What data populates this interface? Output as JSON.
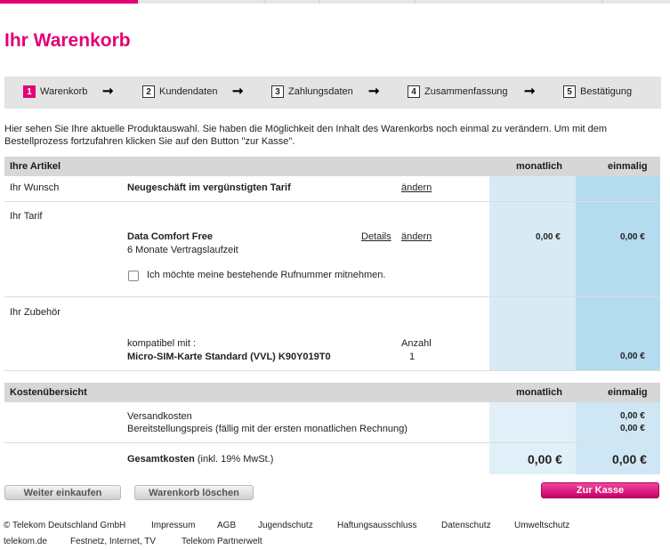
{
  "page": {
    "title": "Ihr Warenkorb"
  },
  "steps": [
    {
      "num": "1",
      "label": "Warenkorb"
    },
    {
      "num": "2",
      "label": "Kundendaten"
    },
    {
      "num": "3",
      "label": "Zahlungsdaten"
    },
    {
      "num": "4",
      "label": "Zusammenfassung"
    },
    {
      "num": "5",
      "label": "Bestätigung"
    }
  ],
  "intro": "Hier sehen Sie Ihre aktuelle Produktauswahl. Sie haben die Möglichkeit den Inhalt des Warenkorbs noch einmal zu verändern. Um mit dem Bestellprozess fortzufahren klicken Sie auf den Button \"zur Kasse\".",
  "articles": {
    "header": "Ihre Artikel",
    "col_monthly": "monatlich",
    "col_once": "einmalig",
    "wunsch": {
      "label": "Ihr Wunsch",
      "value": "Neugeschäft im vergünstigten Tarif",
      "change": "ändern"
    },
    "tarif": {
      "label": "Ihr Tarif",
      "name": "Data Comfort Free",
      "term": "6 Monate Vertragslaufzeit",
      "details": "Details",
      "change": "ändern",
      "monthly": "0,00 €",
      "once": "0,00 €",
      "checkbox_label": "Ich möchte meine bestehende Rufnummer mitnehmen."
    },
    "zubehoer": {
      "label": "Ihr Zubehör",
      "compat": "kompatibel mit :",
      "product": "Micro-SIM-Karte Standard (VVL) K90Y019T0",
      "qty_label": "Anzahl",
      "qty": "1",
      "once": "0,00 €"
    }
  },
  "costs": {
    "header": "Kostenübersicht",
    "col_monthly": "monatlich",
    "col_once": "einmalig",
    "shipping": "Versandkosten",
    "provision": "Bereitstellungspreis (fällig mit der ersten monatlichen Rechnung)",
    "shipping_once": "0,00 €",
    "provision_once": "0,00 €",
    "total_label": "Gesamtkosten",
    "total_note": "(inkl. 19% MwSt.)",
    "total_monthly": "0,00 €",
    "total_once": "0,00 €"
  },
  "buttons": {
    "continue": "Weiter einkaufen",
    "clear": "Warenkorb löschen",
    "checkout": "Zur Kasse"
  },
  "footer": {
    "row1": [
      "© Telekom Deutschland GmbH",
      "Impressum",
      "AGB",
      "Jugendschutz",
      "Haftungsausschluss",
      "Datenschutz",
      "Umweltschutz"
    ],
    "row2": [
      "telekom.de",
      "Festnetz, Internet, TV",
      "Telekom Partnerwelt"
    ]
  },
  "colors": {
    "brand": "#e20074",
    "monthly_cell": "#d8ebf5",
    "once_cell": "#b4dcef"
  }
}
